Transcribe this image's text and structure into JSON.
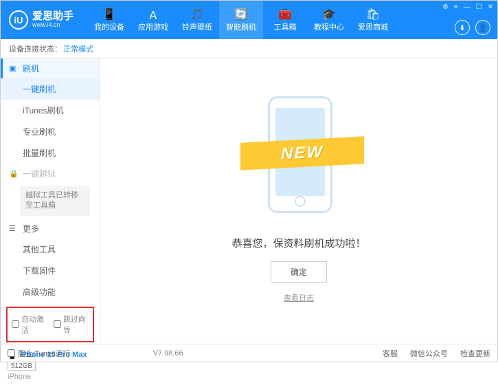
{
  "header": {
    "logo_letter": "iU",
    "logo_title": "爱思助手",
    "logo_url": "www.i4.cn",
    "nav": [
      {
        "icon": "📱",
        "label": "我的设备"
      },
      {
        "icon": "Ａ",
        "label": "应用游戏"
      },
      {
        "icon": "🎵",
        "label": "铃声壁纸"
      },
      {
        "icon": "🔄",
        "label": "智能刷机"
      },
      {
        "icon": "🧰",
        "label": "工具箱"
      },
      {
        "icon": "🎓",
        "label": "教程中心"
      },
      {
        "icon": "🛍",
        "label": "爱思商城"
      }
    ],
    "active_nav": 3,
    "download_icon": "⬇",
    "user_icon": "👤"
  },
  "status": {
    "label": "设备连接状态：",
    "value": "正常模式"
  },
  "sidebar": {
    "flash": {
      "header": "刷机",
      "items": [
        "一键刷机",
        "iTunes刷机",
        "专业刷机",
        "批量刷机"
      ]
    },
    "jailbreak": {
      "header": "一键越狱",
      "note": "越狱工具已转移至工具箱"
    },
    "more": {
      "header": "更多",
      "items": [
        "其他工具",
        "下载固件",
        "高级功能"
      ]
    },
    "checkboxes": {
      "auto_activate": "自动激活",
      "skip_guide": "跳过向导"
    },
    "device": {
      "name": "iPhone 15 Pro Max",
      "storage": "512GB",
      "type": "iPhone"
    }
  },
  "main": {
    "ribbon": "NEW",
    "message": "恭喜您，保资料刷机成功啦！",
    "ok": "确定",
    "log": "查看日志"
  },
  "footer": {
    "block_itunes": "阻止iTunes运行",
    "version": "V7.98.66",
    "links": [
      "客服",
      "微信公众号",
      "检查更新"
    ]
  }
}
